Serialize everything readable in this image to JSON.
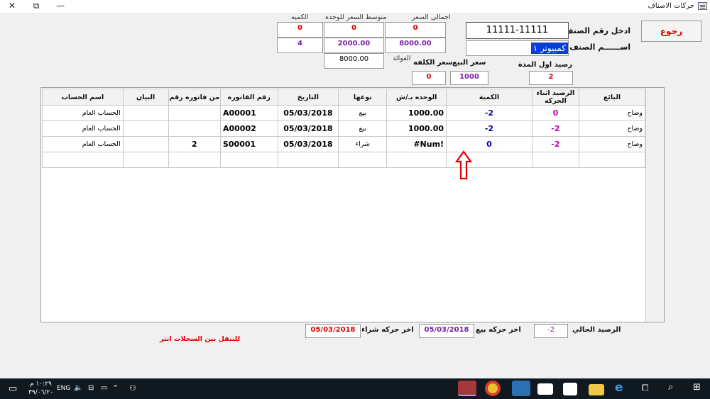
{
  "window": {
    "title": "حركات الاصناف",
    "close_glyph": "✕",
    "restore_glyph": "⧉",
    "minimize_glyph": "—"
  },
  "header": {
    "back_label": "رجوع",
    "code_label": "ادخل رقم الصنف",
    "code_value": "11111-11111",
    "name_label": "اســــــم الصنف",
    "name_value": "كمبيوتر ١",
    "opening_balance_label": "رصيد اول المدة",
    "opening_balance_value": "2",
    "sale_price_label": "سعر البيع",
    "sale_price_value": "1000",
    "cost_price_label": "سعر الكلفه",
    "cost_price_value": "0",
    "total_price_label": "اجمالى السعر",
    "avg_price_label": "متوسط السعر للوحده",
    "qty_label": "الكميه",
    "profit_label": "الفوائد",
    "summary_row1": [
      "0",
      "0",
      "0"
    ],
    "summary_row2": [
      "8000.00",
      "2000.00",
      "4"
    ],
    "profit_value": "8000.00"
  },
  "grid": {
    "columns": [
      "البائع",
      "الرصيد اثناء الحركه",
      "الكمية",
      "الوحده بـ/ش",
      "نوعها",
      "التاريخ",
      "رقم الفاتوره",
      "من فاتوره رقم",
      "البيان",
      "اسم الحساب"
    ],
    "rows": [
      [
        "وضاح",
        "0",
        "-2",
        "1000.00",
        "بيع",
        "05/03/2018",
        "A00001",
        "",
        "",
        "الحساب العام"
      ],
      [
        "وضاح",
        "-2",
        "-2",
        "1000.00",
        "بيع",
        "05/03/2018",
        "A00002",
        "",
        "",
        "الحساب العام"
      ],
      [
        "وضاح",
        "-2",
        "0",
        "#Num!",
        "شراء",
        "05/03/2018",
        "S00001",
        "2",
        "",
        "الحساب العام"
      ]
    ]
  },
  "footer": {
    "current_balance_label": "الرصيد الحالي",
    "current_balance_value": "-2",
    "last_sale_label": "اخر حركه بيع",
    "last_sale_value": "05/03/2018",
    "last_purchase_label": "اخر حركه شراء",
    "last_purchase_value": "05/03/2018",
    "nav_hint": "للتنقل بين السجلات انتر"
  },
  "taskbar": {
    "lang": "ENG",
    "time": "١٠:٢٩ م",
    "date": "٣٩/٠٦/٢٠"
  },
  "colors": {
    "accent_red": "#e00000",
    "purple": "#7a1fa8",
    "navy": "#0000a0",
    "selection": "#0a3fd1",
    "annotation_arrow": "#e00000"
  }
}
